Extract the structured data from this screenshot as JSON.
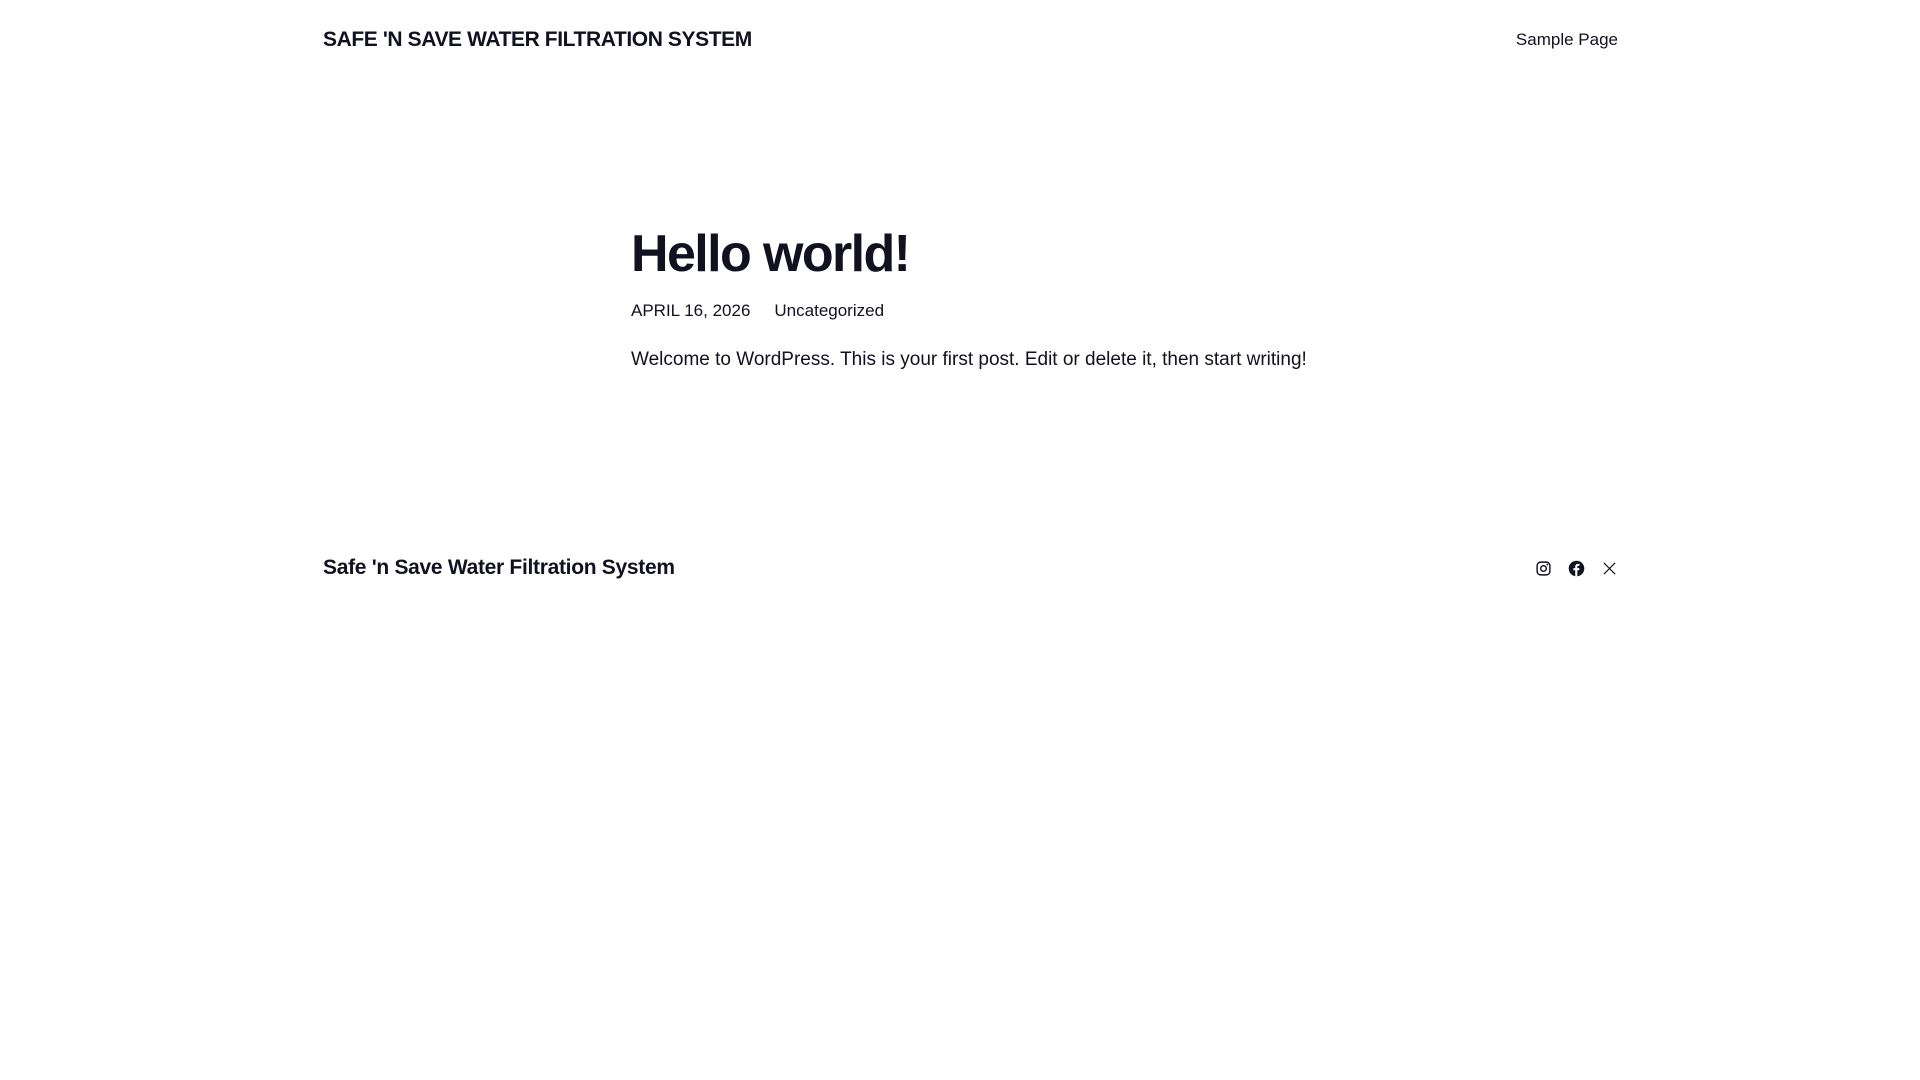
{
  "header": {
    "site_title": "SAFE 'N SAVE WATER FILTRATION SYSTEM",
    "nav": [
      {
        "label": "Sample Page"
      }
    ]
  },
  "post": {
    "title": "Hello world!",
    "date": "APRIL 16, 2026",
    "category": "Uncategorized",
    "content": "Welcome to WordPress. This is your first post. Edit or delete it, then start writing!"
  },
  "footer": {
    "site_title": "Safe 'n Save Water Filtration System",
    "social_icons": [
      "instagram-icon",
      "facebook-icon",
      "x-icon"
    ]
  }
}
